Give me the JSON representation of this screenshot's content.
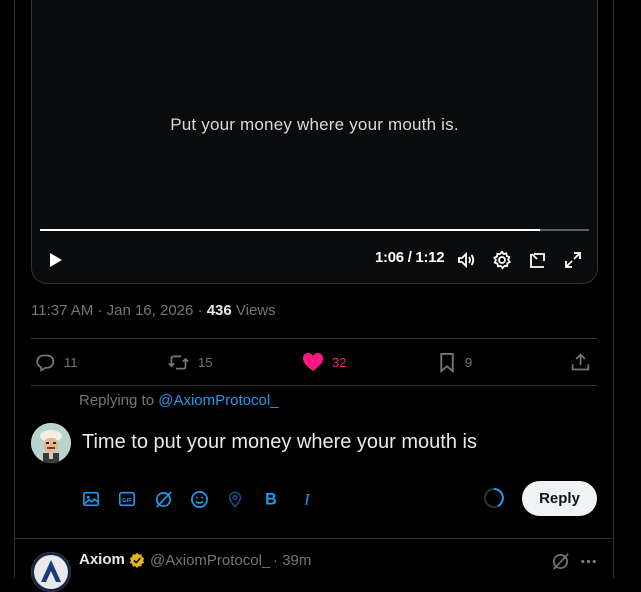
{
  "video": {
    "caption": "Put your money where your mouth is.",
    "time_display": "1:06 / 1:12",
    "progress": 0.91
  },
  "meta": {
    "time": "11:37 AM",
    "date": "Jan 16, 2026",
    "views_count": "436",
    "views_label": "Views"
  },
  "actions": {
    "replies": "11",
    "reposts": "15",
    "likes": "32",
    "bookmarks": "9"
  },
  "reply": {
    "replying_to_label": "Replying to",
    "replying_to_handle": "@AxiomProtocol_",
    "draft_text": "Time to put your money where your mouth is",
    "button_label": "Reply"
  },
  "next_tweet": {
    "name": "Axiom",
    "handle": "@AxiomProtocol_",
    "separator": "·",
    "time": "39m"
  },
  "colors": {
    "accent": "#1d9bf0",
    "like": "#f91880",
    "verified": "#e2b719",
    "muted": "#71767b"
  }
}
